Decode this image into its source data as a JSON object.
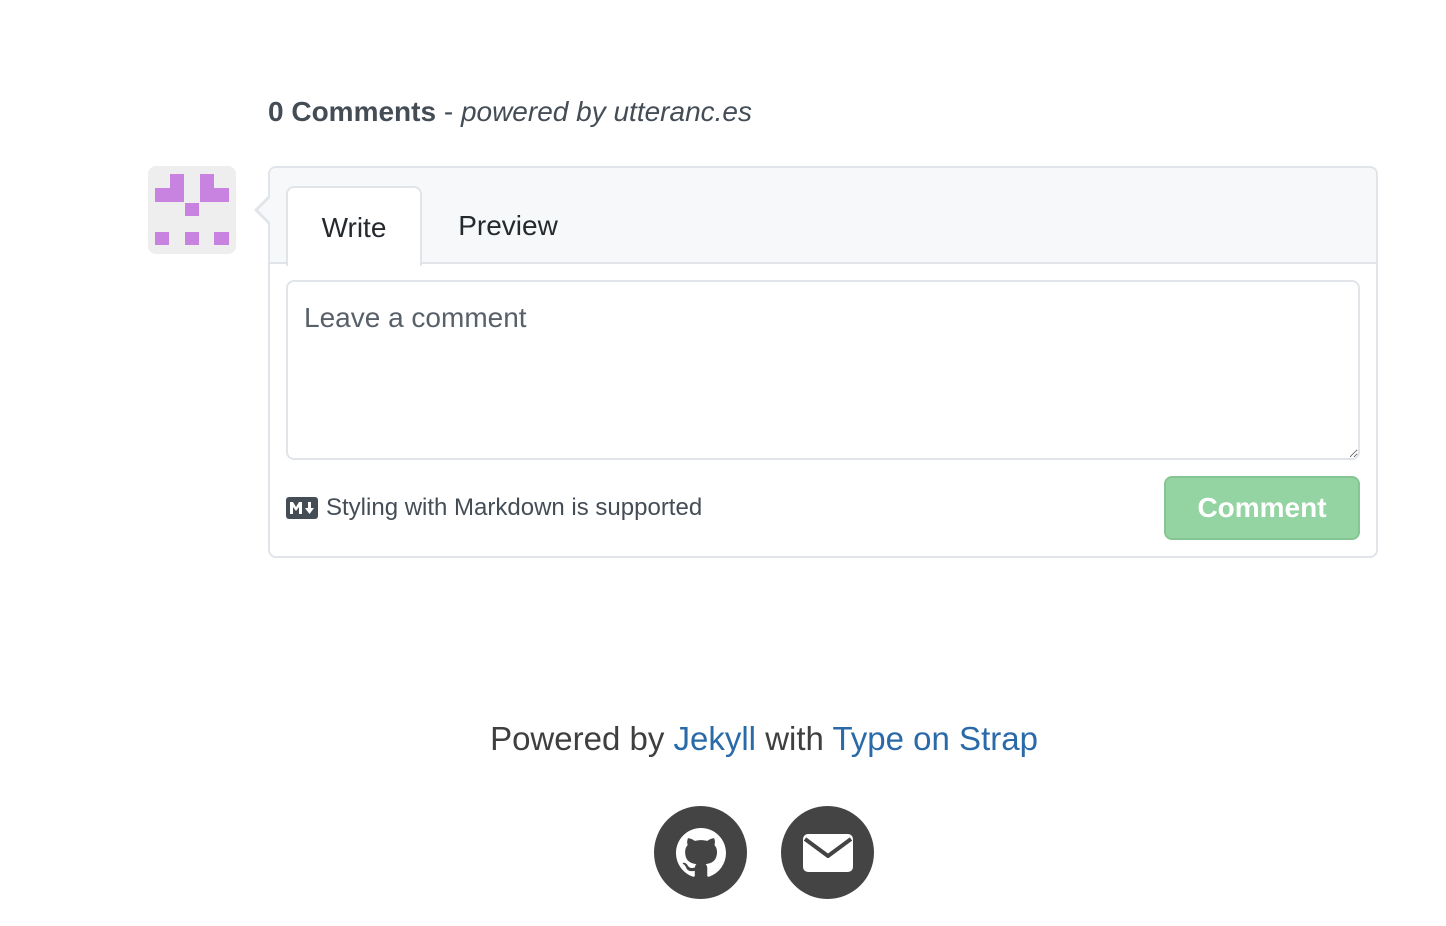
{
  "comments": {
    "count_label": "0 Comments",
    "separator": " - ",
    "powered_by": "powered by utteranc.es"
  },
  "editor": {
    "tabs": [
      {
        "label": "Write",
        "active": true
      },
      {
        "label": "Preview",
        "active": false
      }
    ],
    "placeholder": "Leave a comment",
    "value": "",
    "markdown_note": "Styling with Markdown is supported",
    "submit_label": "Comment",
    "submit_enabled": false
  },
  "footer": {
    "powered_by_prefix": "Powered by",
    "link1": "Jekyll",
    "joiner": "with",
    "link2": "Type on Strap",
    "social_icons": [
      "github-icon",
      "envelope-icon"
    ]
  },
  "colors": {
    "accent_link": "#2a6aa8",
    "submit_disabled": "#94d3a2",
    "avatar_pixel": "#c883e0",
    "social_bg": "#444444"
  }
}
